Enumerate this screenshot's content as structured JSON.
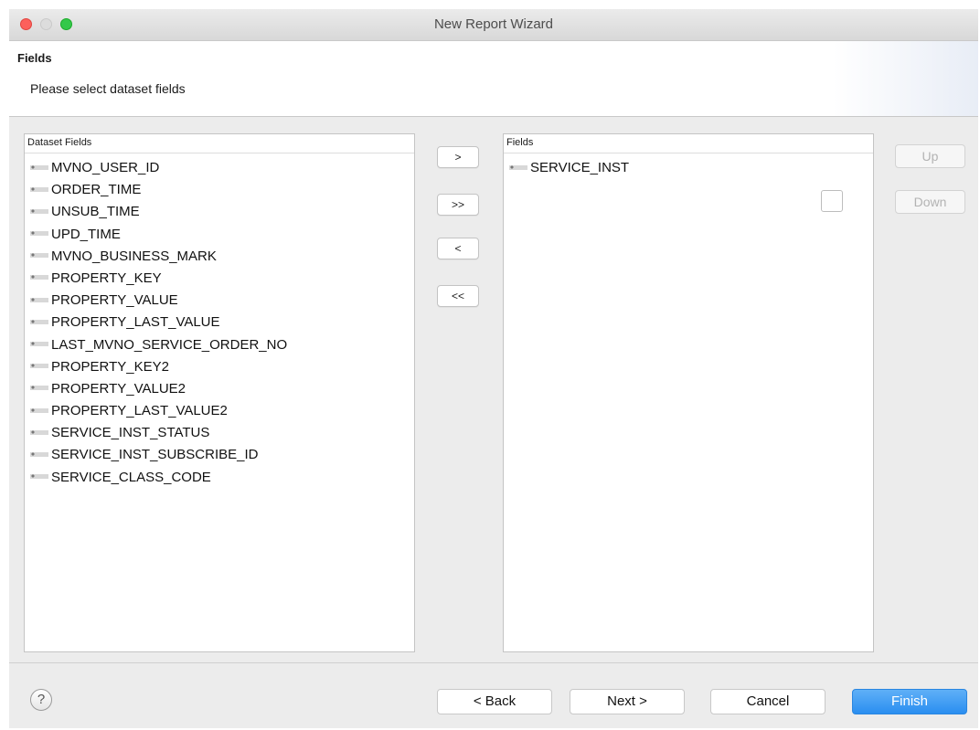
{
  "window": {
    "title": "New Report Wizard"
  },
  "header": {
    "title": "Fields",
    "description": "Please select dataset fields"
  },
  "dataset_fields": {
    "caption": "Dataset Fields",
    "items": [
      "MVNO_USER_ID",
      "ORDER_TIME",
      "UNSUB_TIME",
      "UPD_TIME",
      "MVNO_BUSINESS_MARK",
      "PROPERTY_KEY",
      "PROPERTY_VALUE",
      "PROPERTY_LAST_VALUE",
      "LAST_MVNO_SERVICE_ORDER_NO",
      "PROPERTY_KEY2",
      "PROPERTY_VALUE2",
      "PROPERTY_LAST_VALUE2",
      "SERVICE_INST_STATUS",
      "SERVICE_INST_SUBSCRIBE_ID",
      "SERVICE_CLASS_CODE"
    ]
  },
  "selected_fields": {
    "caption": "Fields",
    "items": [
      "SERVICE_INST"
    ]
  },
  "move_buttons": {
    "add": ">",
    "add_all": ">>",
    "remove": "<",
    "remove_all": "<<"
  },
  "order_buttons": {
    "up": "Up",
    "down": "Down"
  },
  "footer": {
    "help": "?",
    "back": "< Back",
    "next": "Next >",
    "cancel": "Cancel",
    "finish": "Finish"
  },
  "colors": {
    "primary_button": "#2a8ef0",
    "close_light": "#fc605c",
    "zoom_light": "#34c84a"
  }
}
